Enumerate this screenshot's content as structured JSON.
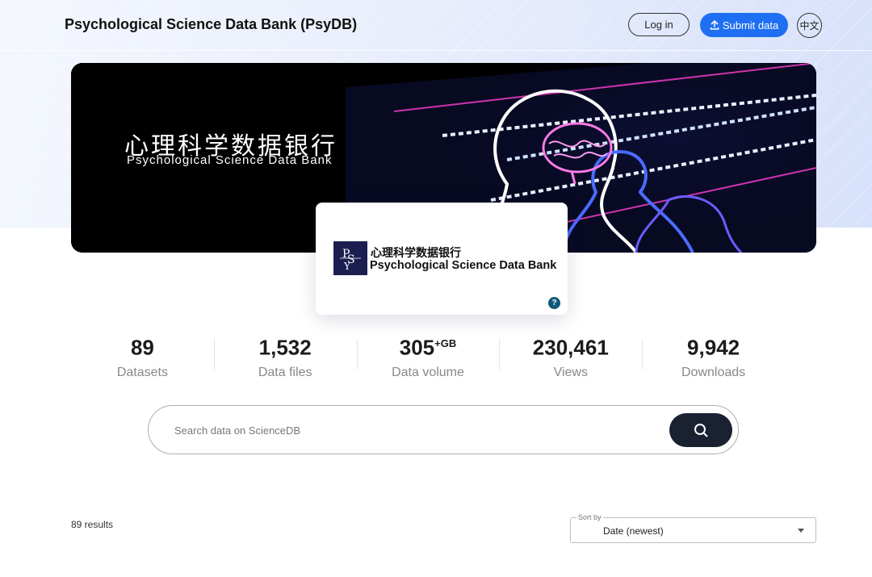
{
  "header": {
    "title": "Psychological Science Data Bank (PsyDB)",
    "login_label": "Log in",
    "submit_label": "Submit data",
    "language_label": "中文"
  },
  "banner": {
    "title_cn": "心理科学数据银行",
    "title_en": "Psychological Science Data Bank"
  },
  "logo_card": {
    "name_cn": "心理科学数据银行",
    "name_en": "Psychological Science Data Bank",
    "help_label": "?"
  },
  "stats": [
    {
      "value": "89",
      "unit": "",
      "label": "Datasets"
    },
    {
      "value": "1,532",
      "unit": "",
      "label": "Data files"
    },
    {
      "value": "305",
      "unit": "+GB",
      "label": "Data volume"
    },
    {
      "value": "230,461",
      "unit": "",
      "label": "Views"
    },
    {
      "value": "9,942",
      "unit": "",
      "label": "Downloads"
    }
  ],
  "search": {
    "placeholder": "Search data on ScienceDB",
    "value": ""
  },
  "results": {
    "count_label": "89 results",
    "sort_by_label": "Sort by",
    "sort_value": "Date (newest)"
  },
  "colors": {
    "accent": "#1f6ff2",
    "search_button": "#1a2232",
    "help_badge": "#0f5a7a"
  },
  "icons": {
    "upload": "upload-icon",
    "search": "search-icon",
    "help": "help-icon",
    "dropdown": "chevron-down-icon"
  }
}
